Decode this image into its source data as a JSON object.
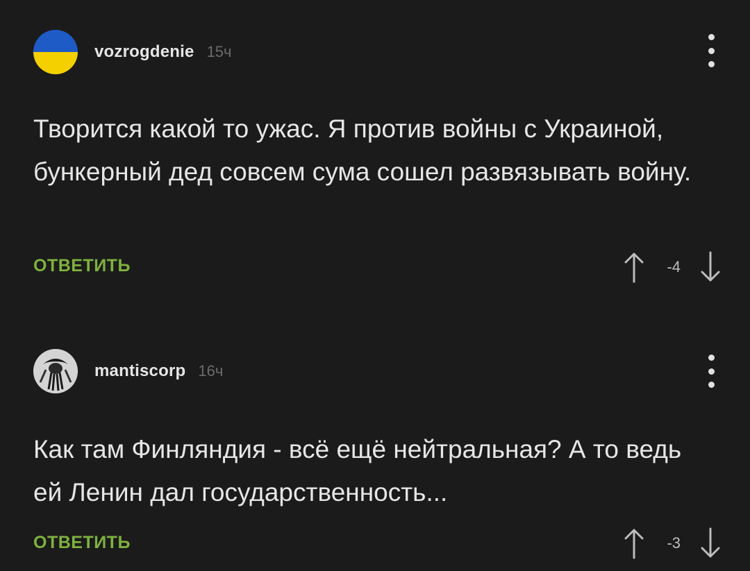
{
  "comments": [
    {
      "username": "vozrogdenie",
      "time": "15ч",
      "avatar_icon": "ukraine-flag-avatar",
      "text": "Творится какой то ужас. Я против войны с Украиной, бункерный дед совсем сума сошел развязывать войну.",
      "reply_label": "ОТВЕТИТЬ",
      "score": "-4"
    },
    {
      "username": "mantiscorp",
      "time": "16ч",
      "avatar_icon": "mantis-avatar",
      "text": "Как там Финляндия - всё ещё нейтральная? А то ведь ей Ленин дал государственность...",
      "reply_label": "ОТВЕТИТЬ",
      "score": "-3"
    }
  ],
  "colors": {
    "background": "#1b1b1b",
    "reply_accent": "#7fb23e",
    "flag_blue": "#1e5bc6",
    "flag_yellow": "#f5d000"
  }
}
